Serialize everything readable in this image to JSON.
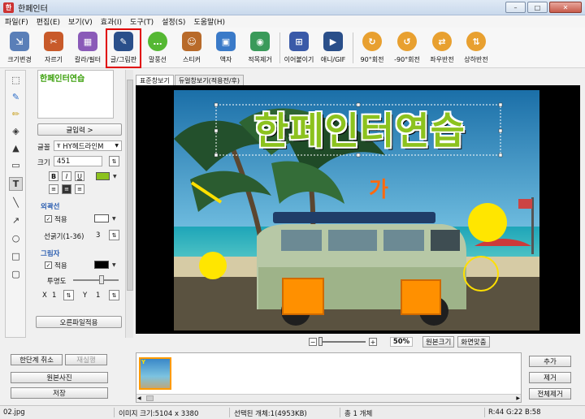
{
  "window": {
    "title": "한페인터",
    "controls": [
      "–",
      "□",
      "✕"
    ]
  },
  "menu": [
    "파일(F)",
    "편집(E)",
    "보기(V)",
    "효과(I)",
    "도구(T)",
    "설정(S)",
    "도움말(H)"
  ],
  "toolbar": [
    {
      "label": "크기변경",
      "icon": "resize-icon",
      "color": "#5a7fb8"
    },
    {
      "label": "자르기",
      "icon": "crop-icon",
      "color": "#c85a2a"
    },
    {
      "label": "칼라/필터",
      "icon": "color-filter-icon",
      "color": "#8a5ab8"
    },
    {
      "label": "글/그림판",
      "icon": "text-paint-icon",
      "color": "#2a4f8a"
    },
    {
      "label": "말풍선",
      "icon": "speech-bubble-icon",
      "color": "#55b833"
    },
    {
      "label": "스티커",
      "icon": "sticker-icon",
      "color": "#b86a2a"
    },
    {
      "label": "액자",
      "icon": "frame-icon",
      "color": "#3a7ac8"
    },
    {
      "label": "적목제거",
      "icon": "red-eye-icon",
      "color": "#3a9a5a"
    },
    {
      "label": "이어붙이기",
      "icon": "merge-icon",
      "color": "#3a5aa8"
    },
    {
      "label": "애니/GIF",
      "icon": "gif-icon",
      "color": "#2a4f8a"
    },
    {
      "label": "90°회전",
      "icon": "rotate-cw-icon",
      "color": "#e8a030"
    },
    {
      "label": "-90°회전",
      "icon": "rotate-ccw-icon",
      "color": "#e8a030"
    },
    {
      "label": "좌우반전",
      "icon": "flip-h-icon",
      "color": "#e8a030"
    },
    {
      "label": "상하반전",
      "icon": "flip-v-icon",
      "color": "#e8a030"
    }
  ],
  "selected_tool": "글/그림판",
  "text_panel": {
    "content": "한페인터연습",
    "input_button": "글입력 >",
    "font_label": "글꼴",
    "font_value": "HY헤드라인M",
    "size_label": "크기",
    "size_value": "451",
    "format": [
      "B",
      "I",
      "U"
    ],
    "text_color": "#8cc21e",
    "outline_section": "외곽선",
    "apply_label": "적용",
    "outline_color": "#ffffff",
    "line_width_label": "선굵기(1-36)",
    "line_width_value": "3",
    "shadow_section": "그림자",
    "shadow_color": "#000000",
    "opacity_label": "투명도",
    "x_label": "X",
    "x_value": "1",
    "y_label": "Y",
    "y_value": "1",
    "object_apply_button": "오른파일적용"
  },
  "tabs": [
    "표준창보기",
    "듀얼창보기(적용전/후)"
  ],
  "canvas": {
    "title_text": "한페인터연습",
    "sticker_text": "가",
    "title_color": "#8cc21e"
  },
  "zoom": {
    "percent": "50%",
    "original_button": "원본크기",
    "fit_button": "화면맞춤"
  },
  "bottom_left": {
    "undo": "한단계 취소",
    "redo": "재실행",
    "original_photo": "원본사진",
    "save": "저장"
  },
  "bottom_right": {
    "add": "추가",
    "remove": "제거",
    "remove_all": "전체제거"
  },
  "status": {
    "file": "02.jpg",
    "image_size": "이미지 크기:5104 x 3380",
    "selected": "선택된 개체:1(4953KB)",
    "total": "총 1 개체",
    "rgb": "R:44 G:22 B:58"
  }
}
